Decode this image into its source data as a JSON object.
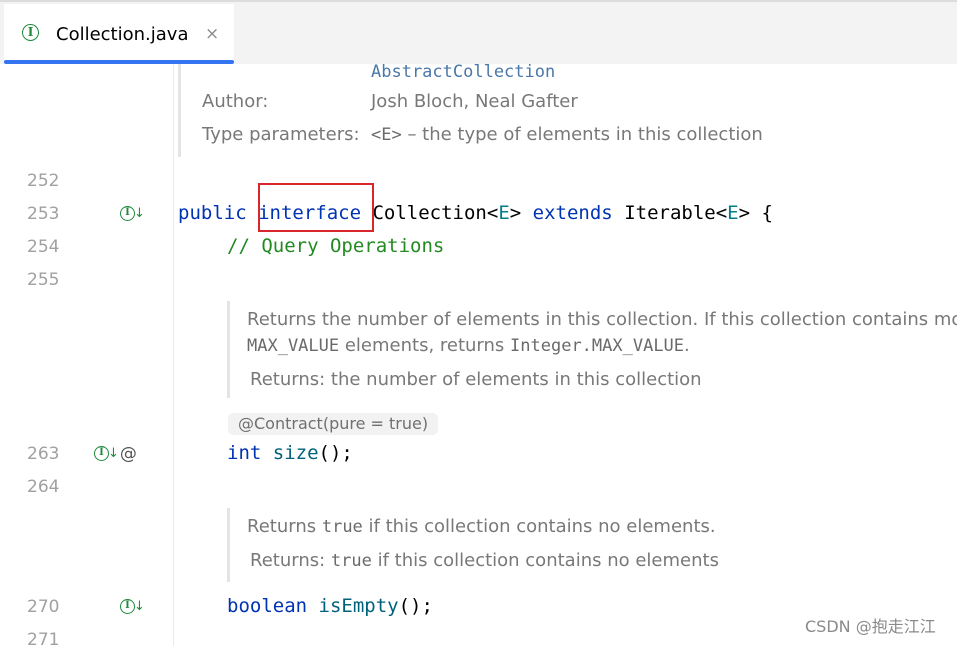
{
  "tab": {
    "label": "Collection.java",
    "icon": "interface-icon",
    "close": "×"
  },
  "doc_top": {
    "see_also_value": "AbstractCollection",
    "author_label": "Author:",
    "author_value": "Josh Bloch, Neal Gafter",
    "type_params_label": "Type parameters:",
    "type_params_code": "<E>",
    "type_params_text": " – the type of elements in this collection"
  },
  "lines": {
    "l252": "252",
    "l253": "253",
    "l254": "254",
    "l255": "255",
    "l263": "263",
    "l264": "264",
    "l270": "270",
    "l271": "271"
  },
  "code": {
    "public": "public",
    "interface": "interface",
    "collection": " Collection<",
    "e1": "E",
    "close1": "> ",
    "extends": "extends",
    "iterable": " Iterable<",
    "e2": "E",
    "close2": "> {",
    "comment": "// Query Operations",
    "int": "int",
    "size": "size",
    "size_rest": "();",
    "boolean": "boolean",
    "isempty": "isEmpty",
    "isempty_rest": "();"
  },
  "doc_size": {
    "line1": "Returns the number of elements in this collection. If this collection contains mo",
    "max_value": "MAX_VALUE",
    "mid": " elements, returns ",
    "integer_max": "Integer.MAX_VALUE",
    "dot": ".",
    "returns": "Returns: the number of elements in this collection"
  },
  "contract": "@Contract(pure = true)",
  "doc_isempty": {
    "returns_word": "Returns ",
    "true_code": "true",
    "rest": " if this collection contains no elements.",
    "returns_label": "Returns: ",
    "true_code2": "true",
    "rest2": " if this collection contains no elements"
  },
  "watermark": "CSDN @抱走江江",
  "colors": {
    "keyword": "#0033b3",
    "comment": "#238a22",
    "method": "#00627a",
    "type_param": "#007e8a",
    "highlight_box": "#d9262c",
    "tab_accent": "#3574f0"
  }
}
